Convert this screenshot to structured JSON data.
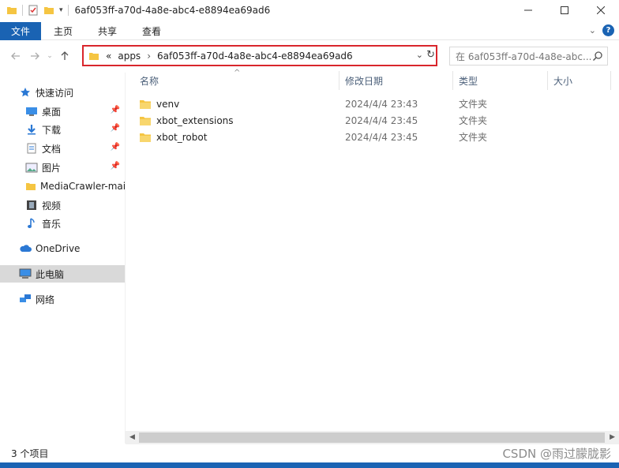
{
  "window": {
    "title": "6af053ff-a70d-4a8e-abc4-e8894ea69ad6"
  },
  "ribbon": {
    "tabs": [
      "文件",
      "主页",
      "共享",
      "查看"
    ],
    "help": "?"
  },
  "address": {
    "overflow": "«",
    "crumbs": [
      "apps",
      "6af053ff-a70d-4a8e-abc4-e8894ea69ad6"
    ],
    "search_placeholder": "在 6af053ff-a70d-4a8e-abc..."
  },
  "sidebar": {
    "quick_access": "快速访问",
    "items": [
      {
        "label": "桌面",
        "icon": "desktop-icon",
        "pinned": true
      },
      {
        "label": "下载",
        "icon": "download-icon",
        "pinned": true
      },
      {
        "label": "文档",
        "icon": "document-icon",
        "pinned": true
      },
      {
        "label": "图片",
        "icon": "picture-icon",
        "pinned": true
      },
      {
        "label": "MediaCrawler-main",
        "icon": "folder-icon",
        "pinned": false
      },
      {
        "label": "视频",
        "icon": "video-icon",
        "pinned": false
      },
      {
        "label": "音乐",
        "icon": "music-icon",
        "pinned": false
      }
    ],
    "onedrive": "OneDrive",
    "this_pc": "此电脑",
    "network": "网络"
  },
  "columns": {
    "name": "名称",
    "modified": "修改日期",
    "type": "类型",
    "size": "大小"
  },
  "files": [
    {
      "name": "venv",
      "modified": "2024/4/4 23:43",
      "type": "文件夹"
    },
    {
      "name": "xbot_extensions",
      "modified": "2024/4/4 23:45",
      "type": "文件夹"
    },
    {
      "name": "xbot_robot",
      "modified": "2024/4/4 23:45",
      "type": "文件夹"
    }
  ],
  "status": {
    "count": "3 个项目"
  },
  "watermark": "CSDN @雨过朦胧影",
  "colors": {
    "accent": "#1a63b3",
    "highlight_border": "#d9262c",
    "folder": "#f5c542"
  }
}
